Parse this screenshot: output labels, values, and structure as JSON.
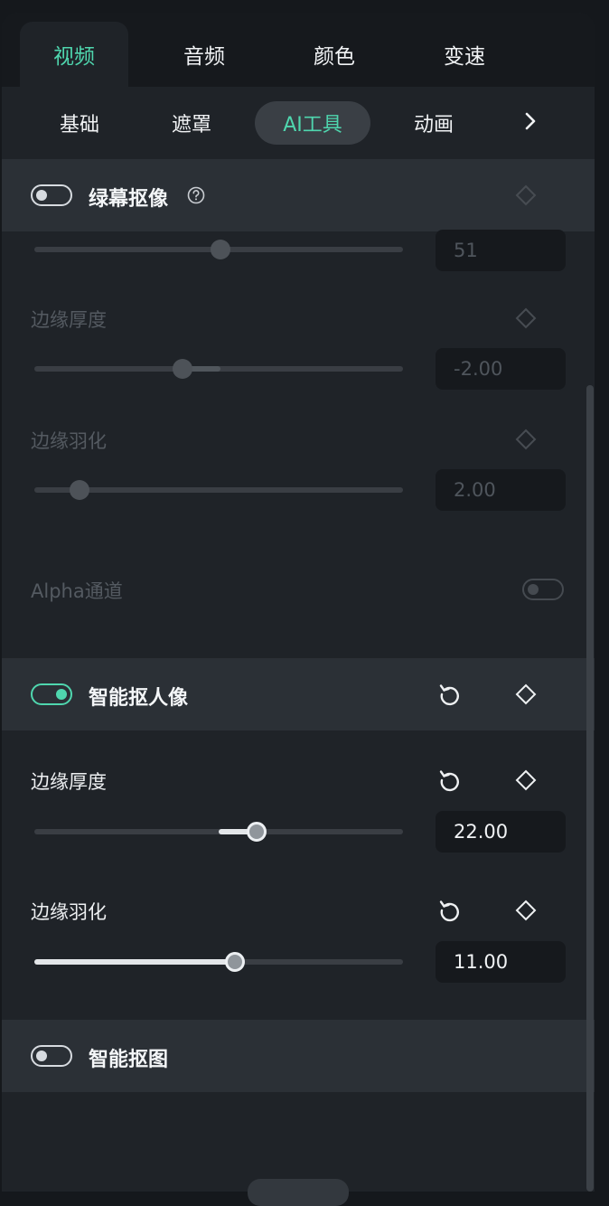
{
  "tabs_main": [
    {
      "label": "视频",
      "active": true
    },
    {
      "label": "音频",
      "active": false
    },
    {
      "label": "颜色",
      "active": false
    },
    {
      "label": "变速",
      "active": false
    }
  ],
  "tabs_sub": [
    {
      "label": "基础",
      "active": false
    },
    {
      "label": "遮罩",
      "active": false
    },
    {
      "label": "AI工具",
      "active": true
    },
    {
      "label": "动画",
      "active": false
    }
  ],
  "accent_color": "#4fd6ae",
  "icons": {
    "next": "chevron-right-icon",
    "help": "question-circle-icon",
    "keyframe": "diamond-icon",
    "reset": "reset-icon"
  },
  "green_screen": {
    "title": "绿幕抠像",
    "enabled": false,
    "top_slider": {
      "value": "51",
      "level": 0.5
    },
    "edge_thickness": {
      "label": "边缘厚度",
      "value": "-2.00",
      "level": 0.4
    },
    "edge_feather": {
      "label": "边缘羽化",
      "value": "2.00",
      "level": 0.12
    },
    "alpha_channel": {
      "label": "Alpha通道",
      "enabled": false
    }
  },
  "smart_portrait": {
    "title": "智能抠人像",
    "enabled": true,
    "edge_thickness": {
      "label": "边缘厚度",
      "value": "22.00",
      "level": 0.61
    },
    "edge_feather": {
      "label": "边缘羽化",
      "value": "11.00",
      "level": 0.55
    }
  },
  "smart_cutout": {
    "title": "智能抠图",
    "enabled": false
  }
}
